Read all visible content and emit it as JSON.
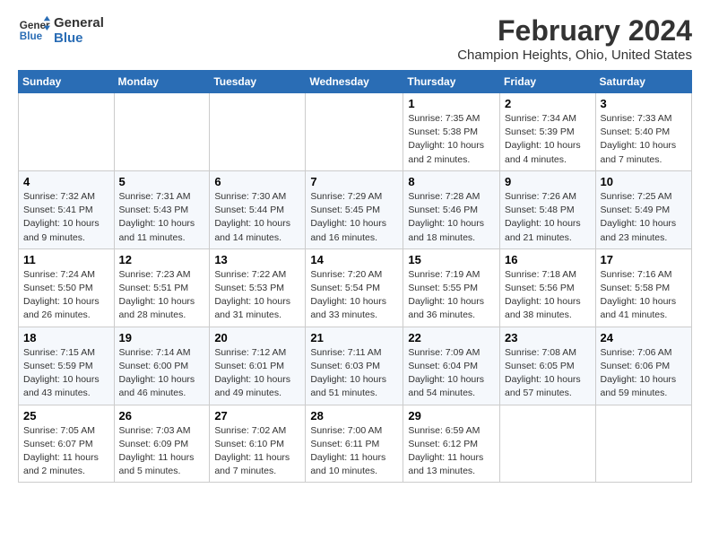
{
  "header": {
    "logo_line1": "General",
    "logo_line2": "Blue",
    "month_title": "February 2024",
    "location": "Champion Heights, Ohio, United States"
  },
  "columns": [
    "Sunday",
    "Monday",
    "Tuesday",
    "Wednesday",
    "Thursday",
    "Friday",
    "Saturday"
  ],
  "weeks": [
    [
      {
        "day": "",
        "info": ""
      },
      {
        "day": "",
        "info": ""
      },
      {
        "day": "",
        "info": ""
      },
      {
        "day": "",
        "info": ""
      },
      {
        "day": "1",
        "info": "Sunrise: 7:35 AM\nSunset: 5:38 PM\nDaylight: 10 hours\nand 2 minutes."
      },
      {
        "day": "2",
        "info": "Sunrise: 7:34 AM\nSunset: 5:39 PM\nDaylight: 10 hours\nand 4 minutes."
      },
      {
        "day": "3",
        "info": "Sunrise: 7:33 AM\nSunset: 5:40 PM\nDaylight: 10 hours\nand 7 minutes."
      }
    ],
    [
      {
        "day": "4",
        "info": "Sunrise: 7:32 AM\nSunset: 5:41 PM\nDaylight: 10 hours\nand 9 minutes."
      },
      {
        "day": "5",
        "info": "Sunrise: 7:31 AM\nSunset: 5:43 PM\nDaylight: 10 hours\nand 11 minutes."
      },
      {
        "day": "6",
        "info": "Sunrise: 7:30 AM\nSunset: 5:44 PM\nDaylight: 10 hours\nand 14 minutes."
      },
      {
        "day": "7",
        "info": "Sunrise: 7:29 AM\nSunset: 5:45 PM\nDaylight: 10 hours\nand 16 minutes."
      },
      {
        "day": "8",
        "info": "Sunrise: 7:28 AM\nSunset: 5:46 PM\nDaylight: 10 hours\nand 18 minutes."
      },
      {
        "day": "9",
        "info": "Sunrise: 7:26 AM\nSunset: 5:48 PM\nDaylight: 10 hours\nand 21 minutes."
      },
      {
        "day": "10",
        "info": "Sunrise: 7:25 AM\nSunset: 5:49 PM\nDaylight: 10 hours\nand 23 minutes."
      }
    ],
    [
      {
        "day": "11",
        "info": "Sunrise: 7:24 AM\nSunset: 5:50 PM\nDaylight: 10 hours\nand 26 minutes."
      },
      {
        "day": "12",
        "info": "Sunrise: 7:23 AM\nSunset: 5:51 PM\nDaylight: 10 hours\nand 28 minutes."
      },
      {
        "day": "13",
        "info": "Sunrise: 7:22 AM\nSunset: 5:53 PM\nDaylight: 10 hours\nand 31 minutes."
      },
      {
        "day": "14",
        "info": "Sunrise: 7:20 AM\nSunset: 5:54 PM\nDaylight: 10 hours\nand 33 minutes."
      },
      {
        "day": "15",
        "info": "Sunrise: 7:19 AM\nSunset: 5:55 PM\nDaylight: 10 hours\nand 36 minutes."
      },
      {
        "day": "16",
        "info": "Sunrise: 7:18 AM\nSunset: 5:56 PM\nDaylight: 10 hours\nand 38 minutes."
      },
      {
        "day": "17",
        "info": "Sunrise: 7:16 AM\nSunset: 5:58 PM\nDaylight: 10 hours\nand 41 minutes."
      }
    ],
    [
      {
        "day": "18",
        "info": "Sunrise: 7:15 AM\nSunset: 5:59 PM\nDaylight: 10 hours\nand 43 minutes."
      },
      {
        "day": "19",
        "info": "Sunrise: 7:14 AM\nSunset: 6:00 PM\nDaylight: 10 hours\nand 46 minutes."
      },
      {
        "day": "20",
        "info": "Sunrise: 7:12 AM\nSunset: 6:01 PM\nDaylight: 10 hours\nand 49 minutes."
      },
      {
        "day": "21",
        "info": "Sunrise: 7:11 AM\nSunset: 6:03 PM\nDaylight: 10 hours\nand 51 minutes."
      },
      {
        "day": "22",
        "info": "Sunrise: 7:09 AM\nSunset: 6:04 PM\nDaylight: 10 hours\nand 54 minutes."
      },
      {
        "day": "23",
        "info": "Sunrise: 7:08 AM\nSunset: 6:05 PM\nDaylight: 10 hours\nand 57 minutes."
      },
      {
        "day": "24",
        "info": "Sunrise: 7:06 AM\nSunset: 6:06 PM\nDaylight: 10 hours\nand 59 minutes."
      }
    ],
    [
      {
        "day": "25",
        "info": "Sunrise: 7:05 AM\nSunset: 6:07 PM\nDaylight: 11 hours\nand 2 minutes."
      },
      {
        "day": "26",
        "info": "Sunrise: 7:03 AM\nSunset: 6:09 PM\nDaylight: 11 hours\nand 5 minutes."
      },
      {
        "day": "27",
        "info": "Sunrise: 7:02 AM\nSunset: 6:10 PM\nDaylight: 11 hours\nand 7 minutes."
      },
      {
        "day": "28",
        "info": "Sunrise: 7:00 AM\nSunset: 6:11 PM\nDaylight: 11 hours\nand 10 minutes."
      },
      {
        "day": "29",
        "info": "Sunrise: 6:59 AM\nSunset: 6:12 PM\nDaylight: 11 hours\nand 13 minutes."
      },
      {
        "day": "",
        "info": ""
      },
      {
        "day": "",
        "info": ""
      }
    ]
  ]
}
